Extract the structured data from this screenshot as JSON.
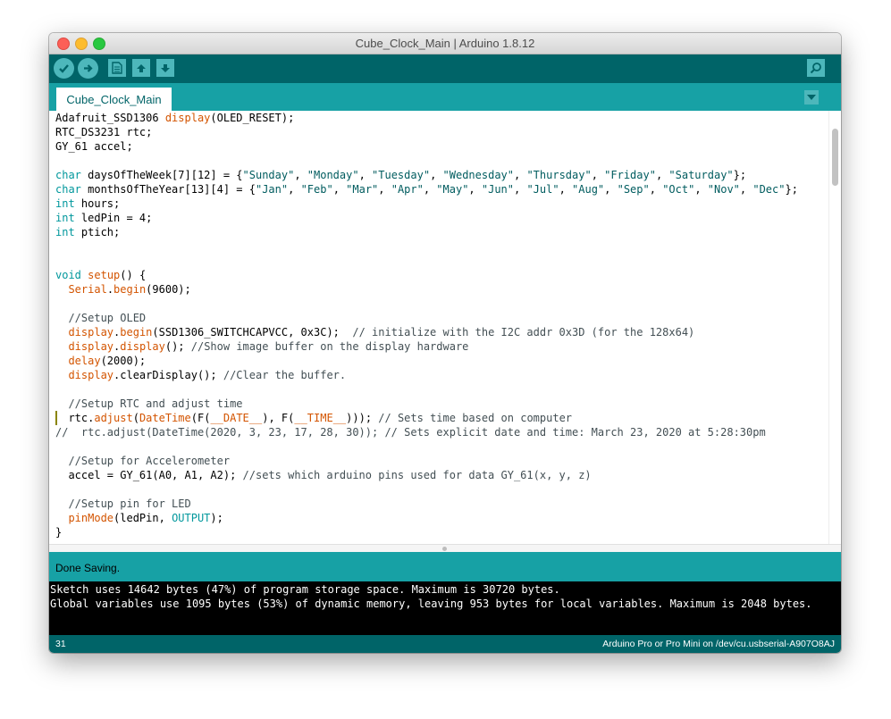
{
  "window": {
    "title": "Cube_Clock_Main | Arduino 1.8.12"
  },
  "toolbar": {
    "buttons": [
      {
        "name": "verify",
        "icon": "checkmark-icon"
      },
      {
        "name": "upload",
        "icon": "arrow-right-icon"
      },
      {
        "name": "new",
        "icon": "new-file-icon"
      },
      {
        "name": "open",
        "icon": "arrow-up-icon"
      },
      {
        "name": "save",
        "icon": "arrow-down-icon"
      },
      {
        "name": "serial-monitor",
        "icon": "magnifier-icon"
      }
    ]
  },
  "tabs": {
    "active": "Cube_Clock_Main",
    "menu_icon": "triangle-down-icon"
  },
  "editor": {
    "lines": [
      [
        {
          "t": "Adafruit_SSD1306 ",
          "c": ""
        },
        {
          "t": "display",
          "c": "f"
        },
        {
          "t": "(OLED_RESET);",
          "c": ""
        }
      ],
      [
        {
          "t": "RTC_DS3231 rtc;",
          "c": ""
        }
      ],
      [
        {
          "t": "GY_61 accel;",
          "c": ""
        }
      ],
      [
        {
          "t": "",
          "c": ""
        }
      ],
      [
        {
          "t": "char",
          "c": "k"
        },
        {
          "t": " daysOfTheWeek[7][12] = {",
          "c": ""
        },
        {
          "t": "\"Sunday\"",
          "c": "s"
        },
        {
          "t": ", ",
          "c": ""
        },
        {
          "t": "\"Monday\"",
          "c": "s"
        },
        {
          "t": ", ",
          "c": ""
        },
        {
          "t": "\"Tuesday\"",
          "c": "s"
        },
        {
          "t": ", ",
          "c": ""
        },
        {
          "t": "\"Wednesday\"",
          "c": "s"
        },
        {
          "t": ", ",
          "c": ""
        },
        {
          "t": "\"Thursday\"",
          "c": "s"
        },
        {
          "t": ", ",
          "c": ""
        },
        {
          "t": "\"Friday\"",
          "c": "s"
        },
        {
          "t": ", ",
          "c": ""
        },
        {
          "t": "\"Saturday\"",
          "c": "s"
        },
        {
          "t": "};",
          "c": ""
        }
      ],
      [
        {
          "t": "char",
          "c": "k"
        },
        {
          "t": " monthsOfTheYear[13][4] = {",
          "c": ""
        },
        {
          "t": "\"Jan\"",
          "c": "s"
        },
        {
          "t": ", ",
          "c": ""
        },
        {
          "t": "\"Feb\"",
          "c": "s"
        },
        {
          "t": ", ",
          "c": ""
        },
        {
          "t": "\"Mar\"",
          "c": "s"
        },
        {
          "t": ", ",
          "c": ""
        },
        {
          "t": "\"Apr\"",
          "c": "s"
        },
        {
          "t": ", ",
          "c": ""
        },
        {
          "t": "\"May\"",
          "c": "s"
        },
        {
          "t": ", ",
          "c": ""
        },
        {
          "t": "\"Jun\"",
          "c": "s"
        },
        {
          "t": ", ",
          "c": ""
        },
        {
          "t": "\"Jul\"",
          "c": "s"
        },
        {
          "t": ", ",
          "c": ""
        },
        {
          "t": "\"Aug\"",
          "c": "s"
        },
        {
          "t": ", ",
          "c": ""
        },
        {
          "t": "\"Sep\"",
          "c": "s"
        },
        {
          "t": ", ",
          "c": ""
        },
        {
          "t": "\"Oct\"",
          "c": "s"
        },
        {
          "t": ", ",
          "c": ""
        },
        {
          "t": "\"Nov\"",
          "c": "s"
        },
        {
          "t": ", ",
          "c": ""
        },
        {
          "t": "\"Dec\"",
          "c": "s"
        },
        {
          "t": "};",
          "c": ""
        }
      ],
      [
        {
          "t": "int",
          "c": "k"
        },
        {
          "t": " hours;",
          "c": ""
        }
      ],
      [
        {
          "t": "int",
          "c": "k"
        },
        {
          "t": " ledPin = 4;",
          "c": ""
        }
      ],
      [
        {
          "t": "int",
          "c": "k"
        },
        {
          "t": " ptich;",
          "c": ""
        }
      ],
      [
        {
          "t": "",
          "c": ""
        }
      ],
      [
        {
          "t": "",
          "c": ""
        }
      ],
      [
        {
          "t": "void",
          "c": "k"
        },
        {
          "t": " ",
          "c": ""
        },
        {
          "t": "setup",
          "c": "f"
        },
        {
          "t": "() {",
          "c": ""
        }
      ],
      [
        {
          "t": "  ",
          "c": ""
        },
        {
          "t": "Serial",
          "c": "f"
        },
        {
          "t": ".",
          "c": ""
        },
        {
          "t": "begin",
          "c": "f"
        },
        {
          "t": "(9600);",
          "c": ""
        }
      ],
      [
        {
          "t": "",
          "c": ""
        }
      ],
      [
        {
          "t": "  //Setup OLED",
          "c": "c"
        }
      ],
      [
        {
          "t": "  ",
          "c": ""
        },
        {
          "t": "display",
          "c": "f"
        },
        {
          "t": ".",
          "c": ""
        },
        {
          "t": "begin",
          "c": "f"
        },
        {
          "t": "(SSD1306_SWITCHCAPVCC, 0x3C);  ",
          "c": ""
        },
        {
          "t": "// initialize with the I2C addr 0x3D (for the 128x64)",
          "c": "c"
        }
      ],
      [
        {
          "t": "  ",
          "c": ""
        },
        {
          "t": "display",
          "c": "f"
        },
        {
          "t": ".",
          "c": ""
        },
        {
          "t": "display",
          "c": "f"
        },
        {
          "t": "(); ",
          "c": ""
        },
        {
          "t": "//Show image buffer on the display hardware",
          "c": "c"
        }
      ],
      [
        {
          "t": "  ",
          "c": ""
        },
        {
          "t": "delay",
          "c": "f"
        },
        {
          "t": "(2000);",
          "c": ""
        }
      ],
      [
        {
          "t": "  ",
          "c": ""
        },
        {
          "t": "display",
          "c": "f"
        },
        {
          "t": ".clearDisplay(); ",
          "c": ""
        },
        {
          "t": "//Clear the buffer.",
          "c": "c"
        }
      ],
      [
        {
          "t": "",
          "c": ""
        }
      ],
      [
        {
          "t": "  //Setup RTC and adjust time",
          "c": "c"
        }
      ],
      [
        {
          "t": "  rtc.",
          "c": ""
        },
        {
          "t": "adjust",
          "c": "f"
        },
        {
          "t": "(",
          "c": ""
        },
        {
          "t": "DateTime",
          "c": "f"
        },
        {
          "t": "(F(",
          "c": ""
        },
        {
          "t": "__DATE__",
          "c": "f"
        },
        {
          "t": "), F(",
          "c": ""
        },
        {
          "t": "__TIME__",
          "c": "f"
        },
        {
          "t": "))); ",
          "c": ""
        },
        {
          "t": "// Sets time based on computer",
          "c": "c"
        }
      ],
      [
        {
          "t": "//  rtc.adjust(DateTime(2020, 3, 23, 17, 28, 30)); // Sets explicit date and time: March 23, 2020 at 5:28:30pm",
          "c": "c"
        }
      ],
      [
        {
          "t": "",
          "c": ""
        }
      ],
      [
        {
          "t": "  //Setup for Accelerometer",
          "c": "c"
        }
      ],
      [
        {
          "t": "  accel = GY_61(A0, A1, A2); ",
          "c": ""
        },
        {
          "t": "//sets which arduino pins used for data GY_61(x, y, z)",
          "c": "c"
        }
      ],
      [
        {
          "t": "",
          "c": ""
        }
      ],
      [
        {
          "t": "  //Setup pin for LED",
          "c": "c"
        }
      ],
      [
        {
          "t": "  ",
          "c": ""
        },
        {
          "t": "pinMode",
          "c": "f"
        },
        {
          "t": "(ledPin, ",
          "c": ""
        },
        {
          "t": "OUTPUT",
          "c": "k"
        },
        {
          "t": ");",
          "c": ""
        }
      ],
      [
        {
          "t": "}",
          "c": ""
        }
      ],
      [
        {
          "t": "",
          "c": ""
        }
      ]
    ]
  },
  "status": {
    "message": "Done Saving."
  },
  "console": {
    "line1": "Sketch uses 14642 bytes (47%) of program storage space. Maximum is 30720 bytes.",
    "line2": "Global variables use 1095 bytes (53%) of dynamic memory, leaving 953 bytes for local variables. Maximum is 2048 bytes."
  },
  "footer": {
    "line_number": "31",
    "board": "Arduino Pro or Pro Mini on /dev/cu.usbserial-A907O8AJ"
  },
  "colors": {
    "toolbar": "#006468",
    "tabbar": "#17a1a5",
    "keyword": "#00979c",
    "function": "#d35400",
    "string": "#005c5f",
    "comment": "#434f54"
  }
}
